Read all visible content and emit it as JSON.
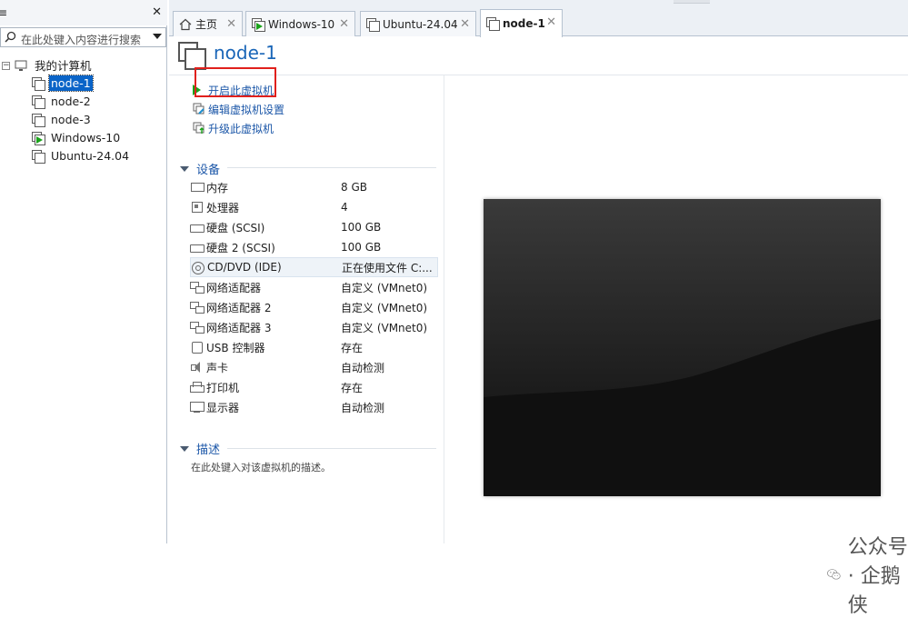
{
  "library": {
    "title_fragment": "≡",
    "search_placeholder": "在此处键入内容进行搜索",
    "root_label": "我的计算机",
    "items": [
      {
        "label": "node-1",
        "selected": true,
        "running": false
      },
      {
        "label": "node-2",
        "selected": false,
        "running": false
      },
      {
        "label": "node-3",
        "selected": false,
        "running": false
      },
      {
        "label": "Windows-10",
        "selected": false,
        "running": true
      },
      {
        "label": "Ubuntu-24.04",
        "selected": false,
        "running": false
      }
    ]
  },
  "tabs": [
    {
      "label": "主页",
      "icon": "home-icon"
    },
    {
      "label": "Windows-10",
      "icon": "vm-running-icon"
    },
    {
      "label": "Ubuntu-24.04",
      "icon": "vm-icon"
    },
    {
      "label": "node-1",
      "icon": "vm-icon",
      "active": true
    }
  ],
  "vm": {
    "title": "node-1",
    "actions": [
      {
        "label": "开启此虚拟机",
        "icon": "play-icon"
      },
      {
        "label": "编辑虚拟机设置",
        "icon": "edit-settings-icon"
      },
      {
        "label": "升级此虚拟机",
        "icon": "upgrade-icon"
      }
    ],
    "devices_title": "设备",
    "devices": [
      {
        "name": "内存",
        "value": "8 GB",
        "icon": "memory-icon"
      },
      {
        "name": "处理器",
        "value": "4",
        "icon": "cpu-icon"
      },
      {
        "name": "硬盘 (SCSI)",
        "value": "100 GB",
        "icon": "hard-disk-icon"
      },
      {
        "name": "硬盘 2 (SCSI)",
        "value": "100 GB",
        "icon": "hard-disk-icon"
      },
      {
        "name": "CD/DVD (IDE)",
        "value": "正在使用文件 C:...",
        "icon": "cd-dvd-icon"
      },
      {
        "name": "网络适配器",
        "value": "自定义 (VMnet0)",
        "icon": "network-adapter-icon"
      },
      {
        "name": "网络适配器 2",
        "value": "自定义 (VMnet0)",
        "icon": "network-adapter-icon"
      },
      {
        "name": "网络适配器 3",
        "value": "自定义 (VMnet0)",
        "icon": "network-adapter-icon"
      },
      {
        "name": "USB 控制器",
        "value": "存在",
        "icon": "usb-icon"
      },
      {
        "name": "声卡",
        "value": "自动检测",
        "icon": "sound-card-icon"
      },
      {
        "name": "打印机",
        "value": "存在",
        "icon": "printer-icon"
      },
      {
        "name": "显示器",
        "value": "自动检测",
        "icon": "display-icon"
      }
    ],
    "description_title": "描述",
    "description_hint": "在此处键入对该虚拟机的描述。"
  },
  "watermark": "公众号 · 企鹅侠",
  "colors": {
    "accent": "#1c57a8",
    "selection": "#0a64c8",
    "highlight_box": "#e0201c",
    "play": "#1aa31a"
  }
}
